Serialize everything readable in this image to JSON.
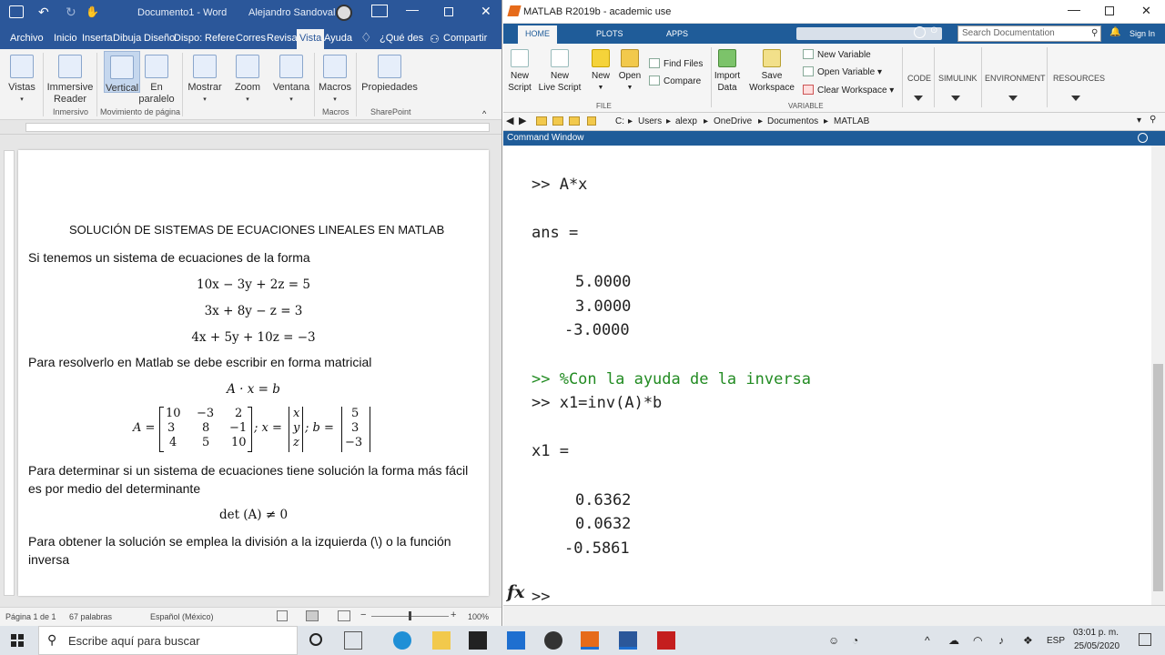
{
  "word": {
    "title": "Documento1 - Word",
    "user": "Alejandro Sandoval",
    "tabs": [
      "Archivo",
      "Inicio",
      "Inserta",
      "Dibuja",
      "Diseño",
      "Dispo:",
      "Refere",
      "Corres",
      "Revisa",
      "Vista",
      "Ayuda",
      "¿Qué des",
      "Compartir"
    ],
    "ribbon": {
      "vistas": "Vistas",
      "immersive": "Immersive\nReader",
      "vertical": "Vertical",
      "paralelo": "En\nparalelo",
      "mostrar": "Mostrar",
      "zoom": "Zoom",
      "ventana": "Ventana",
      "macros": "Macros",
      "propiedades": "Propiedades",
      "groups": [
        "Inmersivo",
        "Movimiento de página",
        "Macros",
        "SharePoint"
      ]
    },
    "doc": {
      "title": "SOLUCIÓN DE SISTEMAS DE ECUACIONES LINEALES EN MATLAB",
      "p1": "Si tenemos un sistema de ecuaciones de la forma",
      "eq1": "10x − 3y + 2z = 5",
      "eq2": "3x + 8y − z = 3",
      "eq3": "4x + 5y + 10z = −3",
      "p2": "Para resolverlo en Matlab se debe escribir en forma matricial",
      "eq4": "A · x = b",
      "matA": [
        "10",
        "−3",
        "2",
        "3",
        "8",
        "−1",
        "4",
        "5",
        "10"
      ],
      "vecx": [
        "x",
        "y",
        "z"
      ],
      "vecb": [
        "5",
        "3",
        "−3"
      ],
      "Alabel": "A =",
      "xlabel": "; x =",
      "blabel": "; b =",
      "p3a": "Para determinar si un sistema de ecuaciones tiene solución la forma más fácil",
      "p3b": "es por medio del determinante",
      "eq5": "det (A) ≠ 0",
      "p4a": "Para obtener la solución se emplea la división a la izquierda (\\) o la función",
      "p4b": "inversa"
    },
    "status": {
      "page": "Página 1 de 1",
      "words": "67 palabras",
      "lang": "Español (México)",
      "zoom": "100%"
    }
  },
  "matlab": {
    "title": "MATLAB R2019b - academic use",
    "tabs": [
      "HOME",
      "PLOTS",
      "APPS"
    ],
    "search_placeholder": "Search Documentation",
    "signin": "Sign In",
    "buttons": {
      "new_script": "New\nScript",
      "new_live": "New\nLive Script",
      "new": "New",
      "open": "Open",
      "find_files": "Find Files",
      "compare": "Compare",
      "import": "Import\nData",
      "save_ws": "Save\nWorkspace",
      "new_var": "New Variable",
      "open_var": "Open Variable",
      "clear_ws": "Clear Workspace"
    },
    "groups": {
      "file": "FILE",
      "variable": "VARIABLE"
    },
    "sections": [
      "CODE",
      "SIMULINK",
      "ENVIRONMENT",
      "RESOURCES"
    ],
    "path": [
      "C:",
      "Users",
      "alexp",
      "OneDrive",
      "Documentos",
      "MATLAB"
    ],
    "cw_title": "Command Window",
    "cw_lines": [
      ">> A*x",
      "ans =",
      "5.0000",
      "3.0000",
      "-3.0000",
      ">> %Con la ayuda de la inversa",
      ">> x1=inv(A)*b",
      "x1 =",
      "0.6362",
      "0.0632",
      "-0.5861"
    ],
    "prompt": ">>"
  },
  "taskbar": {
    "search": "Escribe aquí para buscar",
    "lang": "ESP",
    "time": "03:01 p. m.",
    "date": "25/05/2020"
  }
}
